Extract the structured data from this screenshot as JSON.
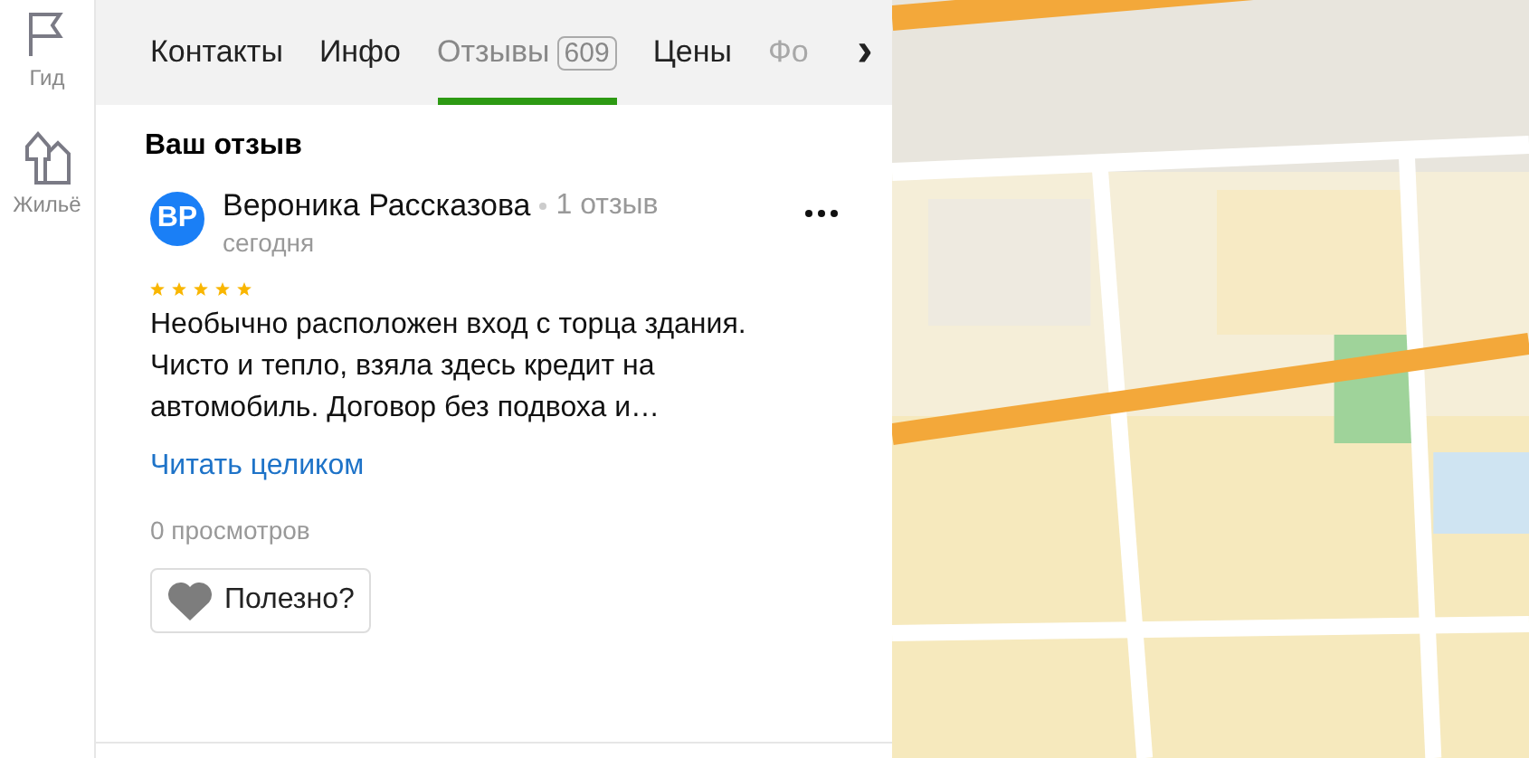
{
  "sidebar": {
    "items": [
      {
        "kind": "flag",
        "label": "Гид"
      },
      {
        "kind": "house",
        "label": "Жильё"
      }
    ]
  },
  "tabs": [
    {
      "label": "Контакты",
      "selected": false,
      "faded": false
    },
    {
      "label": "Инфо",
      "selected": false,
      "faded": false
    },
    {
      "label": "Отзывы",
      "count": "609",
      "selected": true,
      "faded": false
    },
    {
      "label": "Цены",
      "selected": false,
      "faded": false
    },
    {
      "label": "Фо",
      "selected": false,
      "faded": true
    }
  ],
  "tabs_next": "›",
  "review": {
    "heading": "Ваш отзыв",
    "avatar": "ВР",
    "author": "Вероника Рассказова",
    "author_reviews": "1 отзыв",
    "date": "сегодня",
    "stars": 5,
    "text": "Необычно расположен вход с торца здания. Чисто и тепло, взяла здесь кредит на автомобиль. Договор без подвоха и…",
    "read_more": "Читать целиком",
    "views": "0 просмотров",
    "useful": "Полезно?"
  }
}
